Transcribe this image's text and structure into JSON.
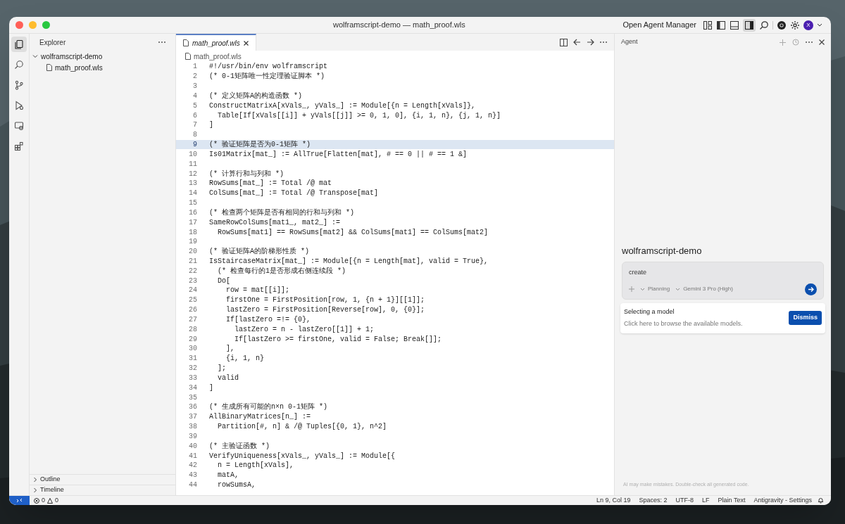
{
  "window": {
    "title": "wolframscript-demo — math_proof.wls"
  },
  "title_bar": {
    "agent_manager": "Open Agent Manager",
    "avatar": "X"
  },
  "activity_bar": [
    {
      "kind": "files",
      "selected": true
    },
    {
      "kind": "search",
      "selected": false
    },
    {
      "kind": "source-control",
      "selected": false
    },
    {
      "kind": "run",
      "selected": false
    },
    {
      "kind": "remote",
      "selected": false
    },
    {
      "kind": "extensions",
      "selected": false
    }
  ],
  "explorer": {
    "title": "Explorer",
    "tree": [
      {
        "label": "wolframscript-demo",
        "expanded": true,
        "children": [
          {
            "label": "math_proof.wls"
          }
        ]
      }
    ],
    "sections": [
      {
        "label": "Outline",
        "expanded": false
      },
      {
        "label": "Timeline",
        "expanded": false
      }
    ]
  },
  "editor": {
    "tabs": [
      {
        "label": "math_proof.wls",
        "selected": true
      }
    ],
    "breadcrumb": "math_proof.wls",
    "lines": [
      {
        "number": "1",
        "text": "#!/usr/bin/env wolframscript",
        "selected": false
      },
      {
        "number": "2",
        "text": "(* 0-1矩阵唯一性定理验证脚本 *)",
        "selected": false
      },
      {
        "number": "3",
        "selected": false
      },
      {
        "number": "4",
        "text": "(* 定义矩阵A的构造函数 *)",
        "selected": false
      },
      {
        "number": "5",
        "text": "ConstructMatrixA[xVals_, yVals_] := Module[{n = Length[xVals]},",
        "selected": false
      },
      {
        "number": "6",
        "text": "  Table[If[xVals[[i]] + yVals[[j]] >= 0, 1, 0], {i, 1, n}, {j, 1, n}]",
        "selected": false
      },
      {
        "number": "7",
        "text": "]",
        "selected": false
      },
      {
        "number": "8",
        "selected": false
      },
      {
        "number": "9",
        "text": "(* 验证矩阵是否为0-1矩阵 *)",
        "selected": true
      },
      {
        "number": "10",
        "text": "Is01Matrix[mat_] := AllTrue[Flatten[mat], # == 0 || # == 1 &]",
        "selected": false
      },
      {
        "number": "11",
        "selected": false
      },
      {
        "number": "12",
        "text": "(* 计算行和与列和 *)",
        "selected": false
      },
      {
        "number": "13",
        "text": "RowSums[mat_] := Total /@ mat",
        "selected": false
      },
      {
        "number": "14",
        "text": "ColSums[mat_] := Total /@ Transpose[mat]",
        "selected": false
      },
      {
        "number": "15",
        "selected": false
      },
      {
        "number": "16",
        "text": "(* 检查两个矩阵是否有相同的行和与列和 *)",
        "selected": false
      },
      {
        "number": "17",
        "text": "SameRowColSums[mat1_, mat2_] :=",
        "selected": false
      },
      {
        "number": "18",
        "text": "  RowSums[mat1] == RowSums[mat2] && ColSums[mat1] == ColSums[mat2]",
        "selected": false
      },
      {
        "number": "19",
        "selected": false
      },
      {
        "number": "20",
        "text": "(* 验证矩阵A的阶梯形性质 *)",
        "selected": false
      },
      {
        "number": "21",
        "text": "IsStaircaseMatrix[mat_] := Module[{n = Length[mat], valid = True},",
        "selected": false
      },
      {
        "number": "22",
        "text": "  (* 检查每行的1是否形成右侧连续段 *)",
        "selected": false
      },
      {
        "number": "23",
        "text": "  Do[",
        "selected": false
      },
      {
        "number": "24",
        "text": "    row = mat[[i]];",
        "selected": false
      },
      {
        "number": "25",
        "text": "    firstOne = FirstPosition[row, 1, {n + 1}][[1]];",
        "selected": false
      },
      {
        "number": "26",
        "text": "    lastZero = FirstPosition[Reverse[row], 0, {0}];",
        "selected": false
      },
      {
        "number": "27",
        "text": "    If[lastZero =!= {0},",
        "selected": false
      },
      {
        "number": "28",
        "text": "      lastZero = n - lastZero[[1]] + 1;",
        "selected": false
      },
      {
        "number": "29",
        "text": "      If[lastZero >= firstOne, valid = False; Break[]];",
        "selected": false
      },
      {
        "number": "30",
        "text": "    ],",
        "selected": false
      },
      {
        "number": "31",
        "text": "    {i, 1, n}",
        "selected": false
      },
      {
        "number": "32",
        "text": "  ];",
        "selected": false
      },
      {
        "number": "33",
        "text": "  valid",
        "selected": false
      },
      {
        "number": "34",
        "text": "]",
        "selected": false
      },
      {
        "number": "35",
        "selected": false
      },
      {
        "number": "36",
        "text": "(* 生成所有可能的n×n 0-1矩阵 *)",
        "selected": false
      },
      {
        "number": "37",
        "text": "AllBinaryMatrices[n_] :=",
        "selected": false
      },
      {
        "number": "38",
        "text": "  Partition[#, n] & /@ Tuples[{0, 1}, n^2]",
        "selected": false
      },
      {
        "number": "39",
        "selected": false
      },
      {
        "number": "40",
        "text": "(* 主验证函数 *)",
        "selected": false
      },
      {
        "number": "41",
        "text": "VerifyUniqueness[xVals_, yVals_] := Module[{",
        "selected": false
      },
      {
        "number": "42",
        "text": "  n = Length[xVals],",
        "selected": false
      },
      {
        "number": "43",
        "text": "  matA,",
        "selected": false
      },
      {
        "number": "44",
        "text": "  rowSumsA,",
        "selected": false
      }
    ]
  },
  "agent": {
    "title": "Agent",
    "workspace": "wolframscript-demo",
    "input": {
      "value": "create",
      "mode": "Planning",
      "model": "Gemini 3 Pro (High)"
    },
    "tooltip": {
      "title": "Selecting a model",
      "text": "Click here to browse the available models.",
      "button": "Dismiss"
    },
    "disclaimer": "AI may make mistakes. Double-check all generated code."
  },
  "status_bar": {
    "errors": "0",
    "warnings": "0",
    "items": [
      "Ln 9, Col 19",
      "Spaces: 2",
      "UTF-8",
      "LF",
      "Plain Text",
      "Antigravity - Settings"
    ]
  }
}
